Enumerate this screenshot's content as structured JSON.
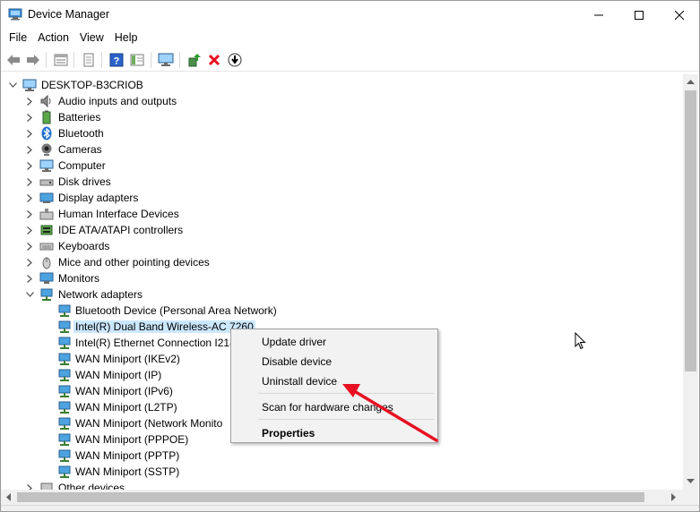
{
  "window": {
    "title": "Device Manager",
    "app_icon": "device-manager-icon"
  },
  "title_buttons": {
    "minimize": "minimize-icon",
    "maximize": "maximize-icon",
    "close": "close-icon"
  },
  "menu": [
    "File",
    "Action",
    "View",
    "Help"
  ],
  "toolbar": [
    "back-arrow-icon",
    "forward-arrow-icon",
    "properties-sheet-icon",
    "document-icon",
    "help-icon",
    "view-panel-icon",
    "monitor-icon",
    "update-driver-icon",
    "uninstall-x-icon",
    "download-icon"
  ],
  "tree": {
    "root": "DESKTOP-B3CRIOB",
    "categories": [
      {
        "label": "Audio inputs and outputs",
        "icon": "speaker-icon"
      },
      {
        "label": "Batteries",
        "icon": "battery-icon"
      },
      {
        "label": "Bluetooth",
        "icon": "bluetooth-icon"
      },
      {
        "label": "Cameras",
        "icon": "camera-icon"
      },
      {
        "label": "Computer",
        "icon": "computer-icon"
      },
      {
        "label": "Disk drives",
        "icon": "disk-icon"
      },
      {
        "label": "Display adapters",
        "icon": "display-icon"
      },
      {
        "label": "Human Interface Devices",
        "icon": "hid-icon"
      },
      {
        "label": "IDE ATA/ATAPI controllers",
        "icon": "controller-icon"
      },
      {
        "label": "Keyboards",
        "icon": "keyboard-icon"
      },
      {
        "label": "Mice and other pointing devices",
        "icon": "mouse-icon"
      },
      {
        "label": "Monitors",
        "icon": "monitor-icon"
      },
      {
        "label": "Network adapters",
        "icon": "network-icon",
        "expanded": true
      }
    ],
    "network_children": [
      "Bluetooth Device (Personal Area Network)",
      "Intel(R) Dual Band Wireless-AC 7260",
      "Intel(R) Ethernet Connection I218",
      "WAN Miniport (IKEv2)",
      "WAN Miniport (IP)",
      "WAN Miniport (IPv6)",
      "WAN Miniport (L2TP)",
      "WAN Miniport (Network Monito",
      "WAN Miniport (PPPOE)",
      "WAN Miniport (PPTP)",
      "WAN Miniport (SSTP)"
    ],
    "selected_child": "Intel(R) Dual Band Wireless-AC 7260",
    "after": "Other devices"
  },
  "context_menu": {
    "items": [
      "Update driver",
      "Disable device",
      "Uninstall device",
      "Scan for hardware changes",
      "Properties"
    ],
    "bold_item": "Properties"
  },
  "annotation": {
    "arrow_color": "#e81123",
    "target": "Uninstall device"
  },
  "colors": {
    "selection": "#cce8ff",
    "menu_bg": "#f2f2f2",
    "scroll_thumb": "#c1c1c1"
  }
}
